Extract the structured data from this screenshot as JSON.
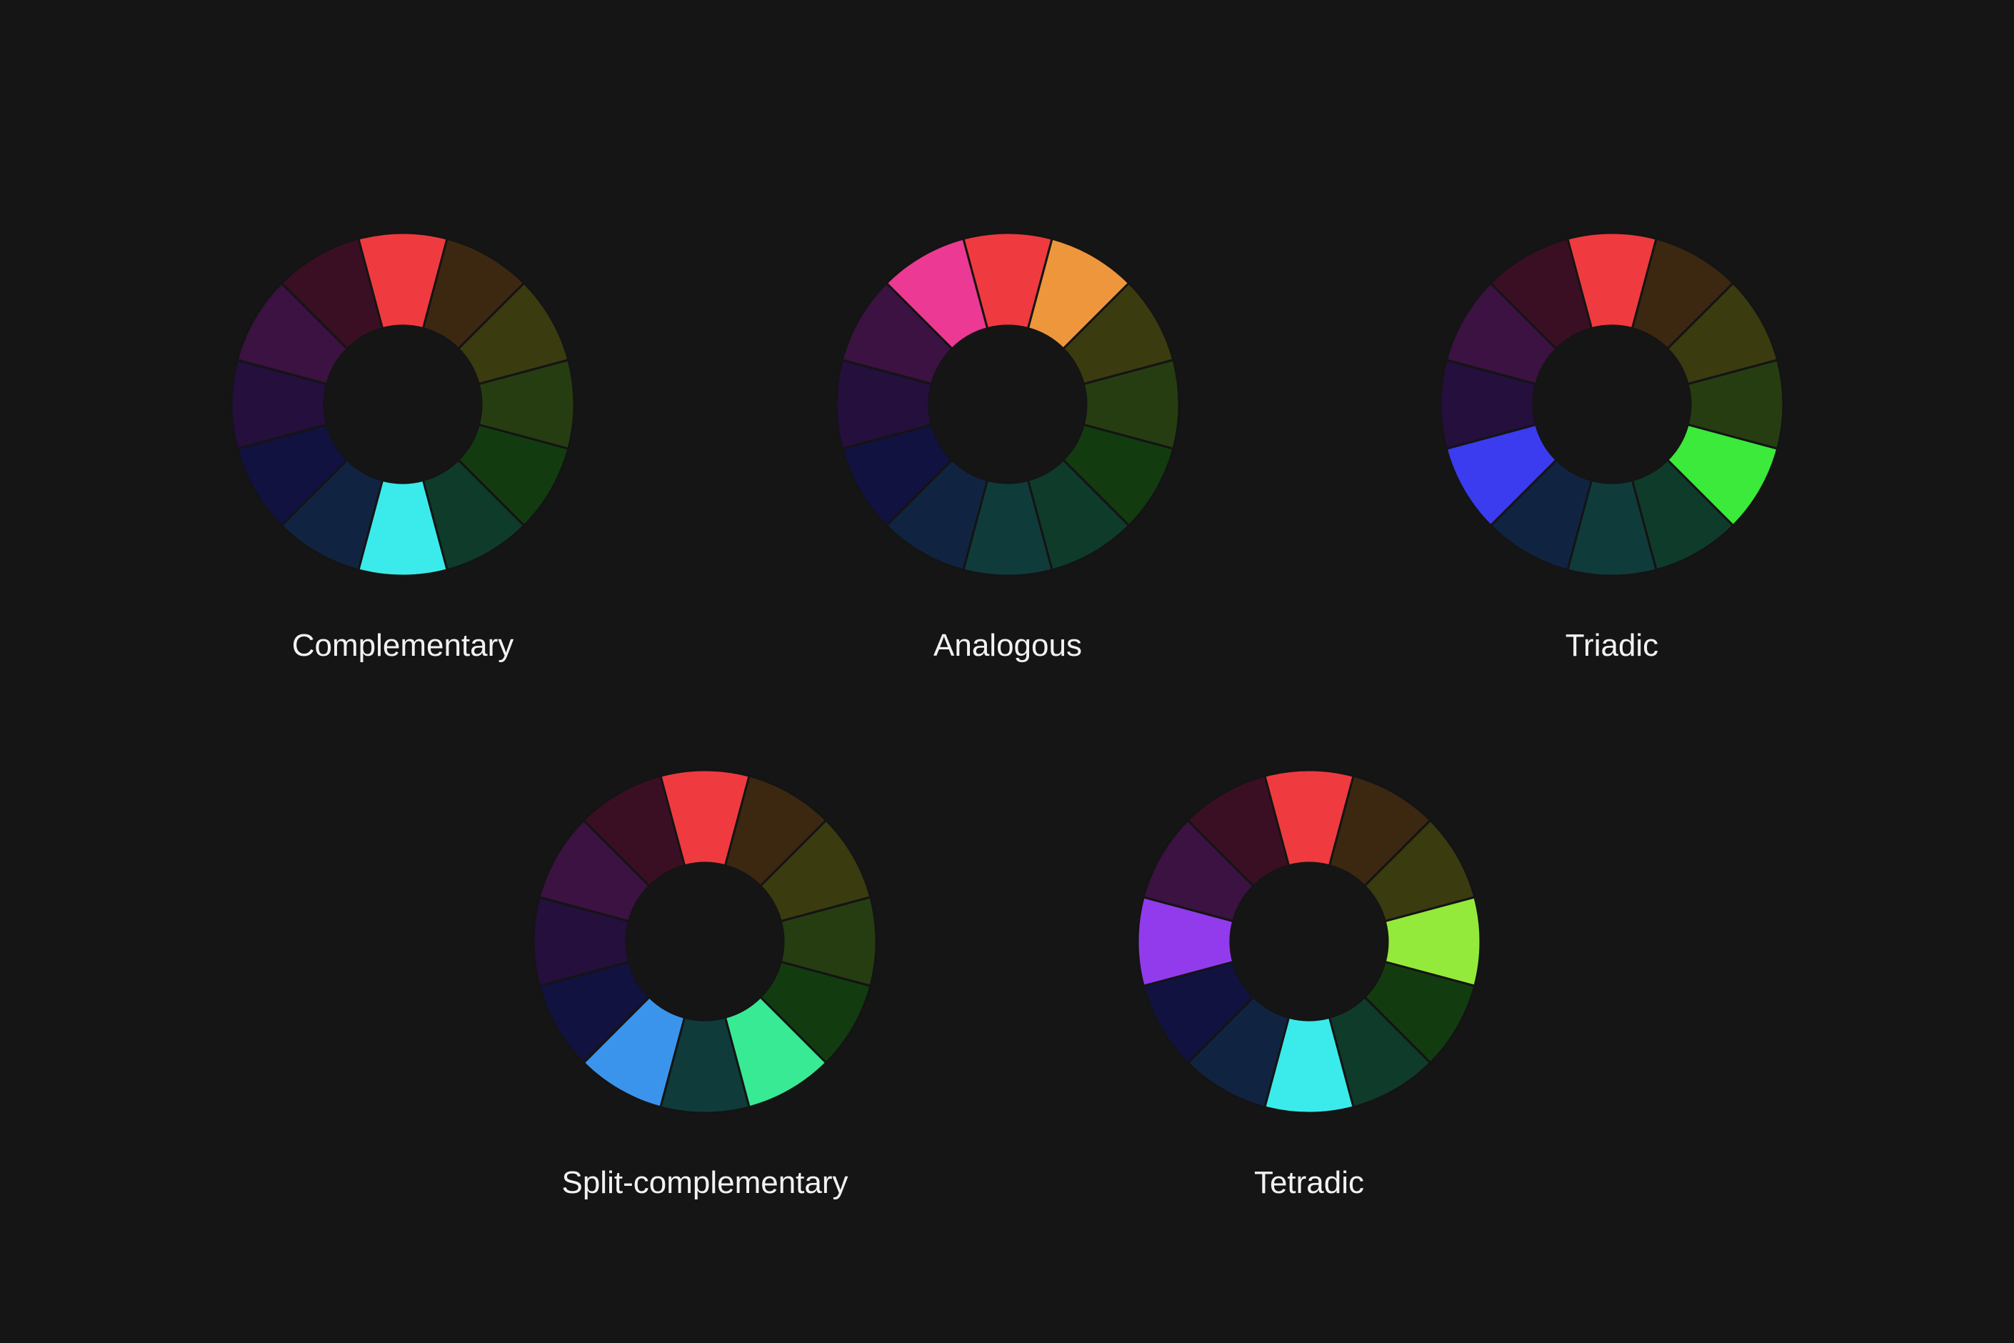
{
  "harmonies": [
    {
      "id": "complementary",
      "label": "Complementary",
      "segments": [
        "#ef3b3f",
        "#3c2811",
        "#3b3b10",
        "#263d12",
        "#123c10",
        "#0f3b2b",
        "#3bebeb",
        "#102442",
        "#11123f",
        "#240f3d",
        "#3b1241",
        "#3b0f23"
      ],
      "highlighted": [
        0,
        6
      ]
    },
    {
      "id": "analogous",
      "label": "Analogous",
      "segments": [
        "#ef3b3f",
        "#ee963b",
        "#3b3b10",
        "#263d12",
        "#123c10",
        "#0f3b2b",
        "#103b3b",
        "#102442",
        "#11123f",
        "#240f3d",
        "#3b1241",
        "#ec3994"
      ],
      "highlighted": [
        11,
        0,
        1
      ]
    },
    {
      "id": "triadic",
      "label": "Triadic",
      "segments": [
        "#ef3b3f",
        "#3c2811",
        "#3b3b10",
        "#263d12",
        "#3bea3b",
        "#0f3b2b",
        "#103b3b",
        "#102442",
        "#3b3bef",
        "#240f3d",
        "#3b1241",
        "#3b0f23"
      ],
      "highlighted": [
        0,
        4,
        8
      ]
    },
    {
      "id": "split-complementary",
      "label": "Split-complementary",
      "segments": [
        "#ef3b3f",
        "#3c2811",
        "#3b3b10",
        "#263d12",
        "#123c10",
        "#38ea93",
        "#103b3b",
        "#3b94ec",
        "#11123f",
        "#240f3d",
        "#3b1241",
        "#3b0f23"
      ],
      "highlighted": [
        0,
        5,
        7
      ]
    },
    {
      "id": "tetradic",
      "label": "Tetradic",
      "segments": [
        "#ef3b3f",
        "#3c2811",
        "#3b3b10",
        "#94ea3b",
        "#123c10",
        "#0f3b2b",
        "#3bebeb",
        "#102442",
        "#11123f",
        "#923bec",
        "#3b1241",
        "#3b0f23"
      ],
      "highlighted": [
        0,
        3,
        6,
        9
      ]
    }
  ]
}
